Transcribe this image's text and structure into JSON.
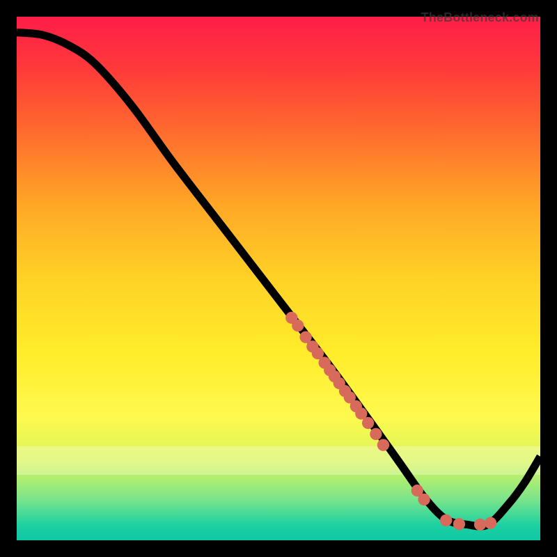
{
  "watermark": "TheBottleneck.com",
  "colors": {
    "curve": "#000000",
    "marker": "#d86a5c",
    "gradient_top": "#ff1d48",
    "gradient_bottom": "#0dc7a6"
  },
  "chart_data": {
    "type": "line",
    "title": "",
    "xlabel": "",
    "ylabel": "",
    "xlim": [
      0,
      100
    ],
    "ylim": [
      0,
      100
    ],
    "curve_pts": [
      [
        0,
        97
      ],
      [
        5,
        96.5
      ],
      [
        10,
        94.5
      ],
      [
        15,
        91
      ],
      [
        22,
        83
      ],
      [
        30,
        72
      ],
      [
        40,
        59
      ],
      [
        50,
        46
      ],
      [
        60,
        33
      ],
      [
        68,
        22
      ],
      [
        73,
        15
      ],
      [
        78,
        8
      ],
      [
        82,
        4
      ],
      [
        86,
        3
      ],
      [
        90,
        3
      ],
      [
        94,
        7
      ],
      [
        97,
        11
      ],
      [
        100,
        16
      ]
    ],
    "markers": [
      [
        52.5,
        42.5
      ],
      [
        53.7,
        41.0
      ],
      [
        55.2,
        38.8
      ],
      [
        56.5,
        37.0
      ],
      [
        57.5,
        35.7
      ],
      [
        58.8,
        33.9
      ],
      [
        59.8,
        32.5
      ],
      [
        60.7,
        31.3
      ],
      [
        61.6,
        30.0
      ],
      [
        62.7,
        28.5
      ],
      [
        63.6,
        27.3
      ],
      [
        64.8,
        25.6
      ],
      [
        65.8,
        24.2
      ],
      [
        67.1,
        22.4
      ],
      [
        68.6,
        20.3
      ],
      [
        70.0,
        18.2
      ],
      [
        76.5,
        9.5
      ],
      [
        77.8,
        7.8
      ],
      [
        82.0,
        3.8
      ],
      [
        84.5,
        3.1
      ],
      [
        88.5,
        3.0
      ],
      [
        90.5,
        3.3
      ]
    ]
  }
}
